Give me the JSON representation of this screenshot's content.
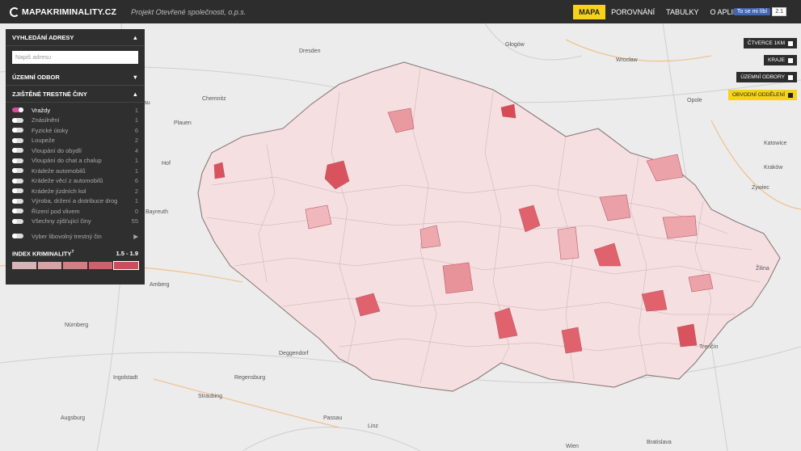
{
  "header": {
    "logo": "MAPAKRIMINALITY.CZ",
    "subtitle": "Projekt Otevřené společnosti, o.p.s.",
    "nav": [
      "MAPA",
      "POROVNÁNÍ",
      "TABULKY",
      "O APLIKACI"
    ],
    "active_nav": "MAPA",
    "fb_label": "To se mi líbí",
    "fb_count": "2.1"
  },
  "panel": {
    "search_title": "VYHLEDÁNÍ ADRESY",
    "search_placeholder": "Napiš adresu",
    "uzemni_title": "ÚZEMNÍ ODBOR",
    "crimes_title": "ZJIŠTĚNÉ TRESTNÉ ČINY",
    "crimes": [
      {
        "label": "Vraždy",
        "count": "1",
        "on": true
      },
      {
        "label": "Znásilnění",
        "count": "1",
        "on": false
      },
      {
        "label": "Fyzické útoky",
        "count": "6",
        "on": false
      },
      {
        "label": "Loupeže",
        "count": "2",
        "on": false
      },
      {
        "label": "Vloupání do obydlí",
        "count": "4",
        "on": false
      },
      {
        "label": "Vloupání do chat a chalup",
        "count": "1",
        "on": false
      },
      {
        "label": "Krádeže automobilů",
        "count": "1",
        "on": false
      },
      {
        "label": "Krádeže věcí z automobilů",
        "count": "6",
        "on": false
      },
      {
        "label": "Krádeže jízdních kol",
        "count": "2",
        "on": false
      },
      {
        "label": "Výroba, držení a distribuce drog",
        "count": "1",
        "on": false
      },
      {
        "label": "Řízení pod vlivem",
        "count": "0",
        "on": false
      },
      {
        "label": "Všechny zjišťující činy",
        "count": "55",
        "on": false
      }
    ],
    "custom_label": "Vyber libovolný trestný čin",
    "index_title": "INDEX KRIMINALITY",
    "index_sup": "?",
    "index_range": "1.5 - 1.9",
    "legend_colors": [
      "#d7b4b8",
      "#d9a2a6",
      "#cf8085",
      "#c9646c",
      "#c8505b"
    ]
  },
  "map_buttons": [
    {
      "label": "ČTVERCE 1KM",
      "active": false
    },
    {
      "label": "KRAJE",
      "active": false
    },
    {
      "label": "ÚZEMNÍ ODBORY",
      "active": false
    },
    {
      "label": "OBVODNÍ ODDĚLENÍ",
      "active": true
    }
  ],
  "places": [
    "Wrocław",
    "Dresden",
    "Zwickau",
    "Plauen",
    "Chemnitz",
    "Opole",
    "Katowice",
    "Regensburg",
    "Straubing",
    "Deggendorf",
    "Passau",
    "Linz",
    "Wien",
    "Trenčín",
    "Augsburg",
    "Ingolstadt",
    "Nürnberg",
    "Amberg",
    "Bayreuth",
    "Hof",
    "Żywiec",
    "Głogów",
    "Kraków",
    "Bratislava",
    "Žilina"
  ]
}
